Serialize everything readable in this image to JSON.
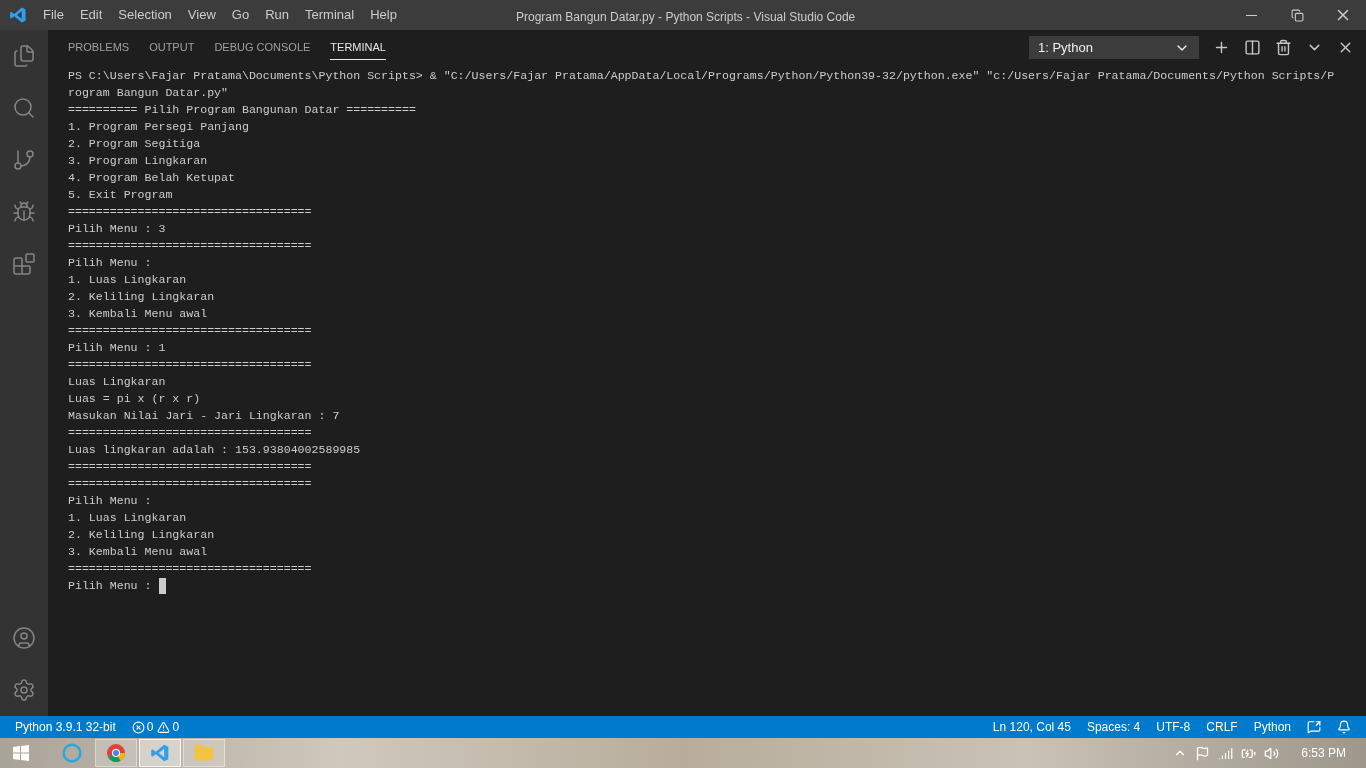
{
  "title_bar": {
    "menu": [
      "File",
      "Edit",
      "Selection",
      "View",
      "Go",
      "Run",
      "Terminal",
      "Help"
    ],
    "title": "Program Bangun Datar.py - Python Scripts - Visual Studio Code"
  },
  "panel": {
    "tabs": [
      {
        "label": "PROBLEMS",
        "selected": false
      },
      {
        "label": "OUTPUT",
        "selected": false
      },
      {
        "label": "DEBUG CONSOLE",
        "selected": false
      },
      {
        "label": "TERMINAL",
        "selected": true
      }
    ],
    "terminal_selector": "1: Python",
    "terminal_lines": [
      "PS C:\\Users\\Fajar Pratama\\Documents\\Python Scripts> & \"C:/Users/Fajar Pratama/AppData/Local/Programs/Python/Python39-32/python.exe\" \"c:/Users/Fajar Pratama/Documents/Python Scripts/P",
      "rogram Bangun Datar.py\"",
      "========== Pilih Program Bangunan Datar ==========",
      "1. Program Persegi Panjang",
      "2. Program Segitiga",
      "3. Program Lingkaran",
      "4. Program Belah Ketupat",
      "5. Exit Program",
      "===================================",
      "Pilih Menu : 3",
      "===================================",
      "Pilih Menu :",
      "1. Luas Lingkaran",
      "2. Keliling Lingkaran",
      "3. Kembali Menu awal",
      "===================================",
      "Pilih Menu : 1",
      "===================================",
      "Luas Lingkaran",
      "Luas = pi x (r x r)",
      "Masukan Nilai Jari - Jari Lingkaran : 7",
      "===================================",
      "Luas lingkaran adalah : 153.93804002589985",
      "===================================",
      "===================================",
      "Pilih Menu :",
      "1. Luas Lingkaran",
      "2. Keliling Lingkaran",
      "3. Kembali Menu awal",
      "==================================="
    ],
    "prompt": "Pilih Menu :"
  },
  "status_bar": {
    "interpreter": "Python 3.9.1 32-bit",
    "errors": "0",
    "warnings": "0",
    "right": [
      "Ln 120, Col 45",
      "Spaces: 4",
      "UTF-8",
      "CRLF",
      "Python"
    ]
  },
  "taskbar": {
    "apps": [
      {
        "kind": "cortana",
        "selected": false
      },
      {
        "kind": "chrome",
        "selected": false
      },
      {
        "kind": "vscode",
        "selected": true
      },
      {
        "kind": "explorer",
        "selected": false
      }
    ],
    "clock": "6:53 PM"
  }
}
